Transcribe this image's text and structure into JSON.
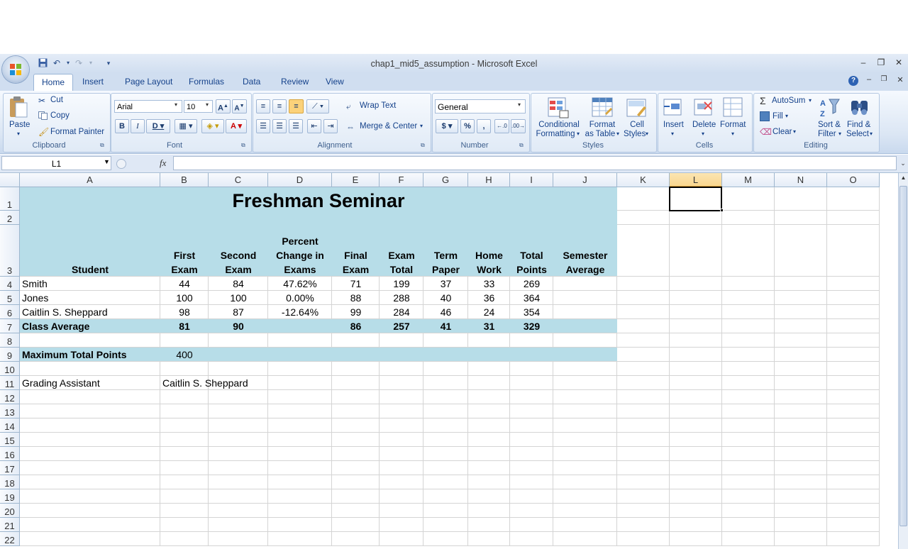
{
  "window": {
    "title": "chap1_mid5_assumption - Microsoft Excel"
  },
  "tabs": [
    "Home",
    "Insert",
    "Page Layout",
    "Formulas",
    "Data",
    "Review",
    "View"
  ],
  "clipboard": {
    "paste": "Paste",
    "cut": "Cut",
    "copy": "Copy",
    "format_painter": "Format Painter",
    "label": "Clipboard"
  },
  "font": {
    "name": "Arial",
    "size": "10",
    "label": "Font"
  },
  "alignment": {
    "wrap": "Wrap Text",
    "merge": "Merge & Center",
    "label": "Alignment"
  },
  "number": {
    "format": "General",
    "label": "Number",
    "currency": "$",
    "percent": "%",
    "comma": ","
  },
  "styles": {
    "conditional_1": "Conditional",
    "conditional_2": "Formatting",
    "format_table_1": "Format",
    "format_table_2": "as Table",
    "cell_styles_1": "Cell",
    "cell_styles_2": "Styles",
    "label": "Styles"
  },
  "cells_group": {
    "insert": "Insert",
    "delete": "Delete",
    "format": "Format",
    "label": "Cells"
  },
  "editing": {
    "autosum": "AutoSum",
    "fill": "Fill",
    "clear": "Clear",
    "sort_1": "Sort &",
    "sort_2": "Filter",
    "find_1": "Find &",
    "find_2": "Select",
    "label": "Editing"
  },
  "formula_bar": {
    "name_box": "L1",
    "fx": "fx",
    "formula": ""
  },
  "columns": [
    "A",
    "B",
    "C",
    "D",
    "E",
    "F",
    "G",
    "H",
    "I",
    "J",
    "K",
    "L",
    "M",
    "N",
    "O"
  ],
  "rows": [
    "1",
    "2",
    "3",
    "4",
    "5",
    "6",
    "7",
    "8",
    "9",
    "10",
    "11",
    "12",
    "13",
    "14",
    "15",
    "16",
    "17",
    "18",
    "19",
    "20",
    "21",
    "22"
  ],
  "sheet": {
    "title": "Freshman Seminar",
    "headers": {
      "student": "Student",
      "first_1": "First",
      "first_2": "Exam",
      "second_1": "Second",
      "second_2": "Exam",
      "pct_1": "Percent",
      "pct_2": "Change in",
      "pct_3": "Exams",
      "final_1": "Final",
      "final_2": "Exam",
      "examtotal_1": "Exam",
      "examtotal_2": "Total",
      "term_1": "Term",
      "term_2": "Paper",
      "home_1": "Home",
      "home_2": "Work",
      "total_1": "Total",
      "total_2": "Points",
      "sem_1": "Semester",
      "sem_2": "Average"
    },
    "students": [
      {
        "name": "Smith",
        "first": "44",
        "second": "84",
        "pct": "47.62%",
        "final": "71",
        "exam_total": "199",
        "term": "37",
        "home": "33",
        "total": "269",
        "sem": ""
      },
      {
        "name": "Jones",
        "first": "100",
        "second": "100",
        "pct": "0.00%",
        "final": "88",
        "exam_total": "288",
        "term": "40",
        "home": "36",
        "total": "364",
        "sem": ""
      },
      {
        "name": "Caitlin S. Sheppard",
        "first": "98",
        "second": "87",
        "pct": "-12.64%",
        "final": "99",
        "exam_total": "284",
        "term": "46",
        "home": "24",
        "total": "354",
        "sem": ""
      }
    ],
    "average": {
      "label": "Class Average",
      "first": "81",
      "second": "90",
      "pct": "",
      "final": "86",
      "exam_total": "257",
      "term": "41",
      "home": "31",
      "total": "329",
      "sem": ""
    },
    "max_label": "Maximum Total Points",
    "max_value": "400",
    "assistant_label": "Grading Assistant",
    "assistant_name": "Caitlin S. Sheppard"
  },
  "colors": {
    "fill": "#b7dde8",
    "selected_header": "#f9d68f"
  }
}
